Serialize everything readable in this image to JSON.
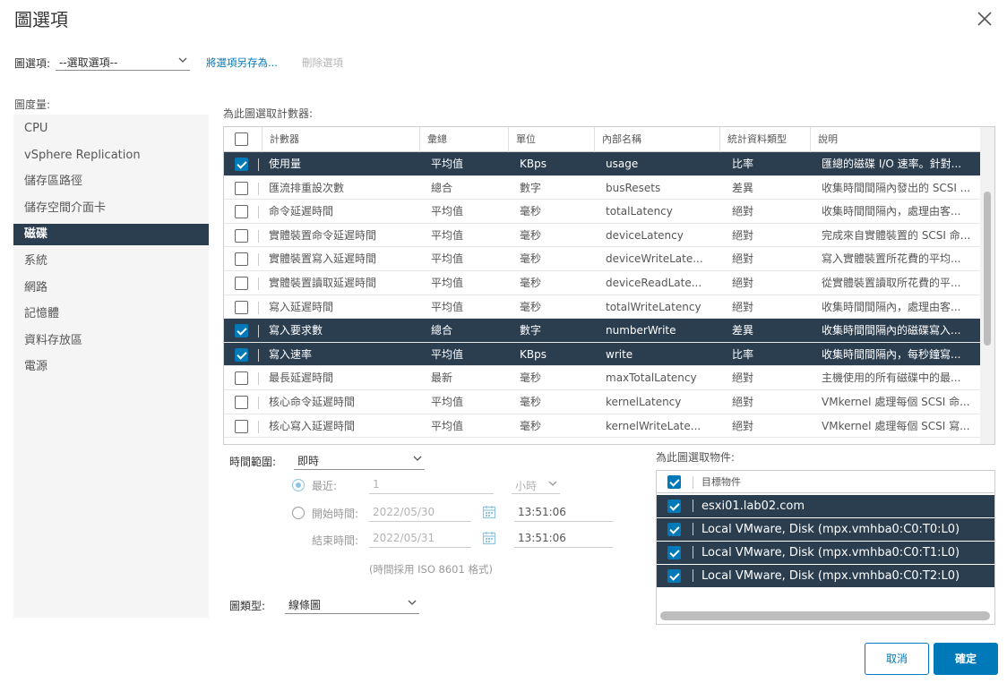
{
  "dialog": {
    "title": "圖選項"
  },
  "options": {
    "label": "圖選項:",
    "select_value": "--選取選項--",
    "save_as": "將選項另存為...",
    "delete": "刪除選項"
  },
  "metrics": {
    "label": "圖度量:",
    "items": [
      "CPU",
      "vSphere Replication",
      "儲存區路徑",
      "儲存空間介面卡",
      "磁碟",
      "系統",
      "網路",
      "記憶體",
      "資料存放區",
      "電源"
    ],
    "active": "磁碟"
  },
  "counters": {
    "label": "為此圖選取計數器:",
    "headers": [
      "計數器",
      "彙總",
      "單位",
      "內部名稱",
      "統計資料類型",
      "說明"
    ],
    "rows": [
      {
        "name": "使用量",
        "rollup": "平均值",
        "unit": "KBps",
        "internal": "usage",
        "stat": "比率",
        "desc": "匯總的磁碟 I/O 速率。針對...",
        "selected": true
      },
      {
        "name": "匯流排重設次數",
        "rollup": "總合",
        "unit": "數字",
        "internal": "busResets",
        "stat": "差異",
        "desc": "收集時間間隔內發出的 SCSI ...",
        "selected": false
      },
      {
        "name": "命令延遲時間",
        "rollup": "平均值",
        "unit": "毫秒",
        "internal": "totalLatency",
        "stat": "絕對",
        "desc": "收集時間間隔內，處理由客...",
        "selected": false
      },
      {
        "name": "實體裝置命令延遲時間",
        "rollup": "平均值",
        "unit": "毫秒",
        "internal": "deviceLatency",
        "stat": "絕對",
        "desc": "完成來自實體裝置的 SCSI 命...",
        "selected": false
      },
      {
        "name": "實體裝置寫入延遲時間",
        "rollup": "平均值",
        "unit": "毫秒",
        "internal": "deviceWriteLate...",
        "stat": "絕對",
        "desc": "寫入實體裝置所花費的平均...",
        "selected": false
      },
      {
        "name": "實體裝置讀取延遲時間",
        "rollup": "平均值",
        "unit": "毫秒",
        "internal": "deviceReadLate...",
        "stat": "絕對",
        "desc": "從實體裝置讀取所花費的平...",
        "selected": false
      },
      {
        "name": "寫入延遲時間",
        "rollup": "平均值",
        "unit": "毫秒",
        "internal": "totalWriteLatency",
        "stat": "絕對",
        "desc": "收集時間間隔內，處理由客...",
        "selected": false
      },
      {
        "name": "寫入要求數",
        "rollup": "總合",
        "unit": "數字",
        "internal": "numberWrite",
        "stat": "差異",
        "desc": "收集時間間隔內的磁碟寫入...",
        "selected": true
      },
      {
        "name": "寫入速率",
        "rollup": "平均值",
        "unit": "KBps",
        "internal": "write",
        "stat": "比率",
        "desc": "收集時間間隔內，每秒鐘寫...",
        "selected": true
      },
      {
        "name": "最長延遲時間",
        "rollup": "最新",
        "unit": "毫秒",
        "internal": "maxTotalLatency",
        "stat": "絕對",
        "desc": "主機使用的所有磁碟中的最...",
        "selected": false
      },
      {
        "name": "核心命令延遲時間",
        "rollup": "平均值",
        "unit": "毫秒",
        "internal": "kernelLatency",
        "stat": "絕對",
        "desc": "VMkernel 處理每個 SCSI 命...",
        "selected": false
      },
      {
        "name": "核心寫入延遲時間",
        "rollup": "平均值",
        "unit": "毫秒",
        "internal": "kernelWriteLate...",
        "stat": "絕對",
        "desc": "VMkernel 處理每個 SCSI 寫...",
        "selected": false
      }
    ]
  },
  "timerange": {
    "label": "時間範圍:",
    "value": "即時",
    "recent_label": "最近:",
    "recent_value": "1",
    "recent_unit": "小時",
    "start_label": "開始時間:",
    "start_date": "2022/05/30",
    "start_time": "13:51:06",
    "end_label": "結束時間:",
    "end_date": "2022/05/31",
    "end_time": "13:51:06",
    "hint": "(時間採用 ISO 8601 格式)"
  },
  "charttype": {
    "label": "圖類型:",
    "value": "線條圖"
  },
  "objects": {
    "label": "為此圖選取物件:",
    "header": "目標物件",
    "rows": [
      "esxi01.lab02.com",
      "Local VMware, Disk (mpx.vmhba0:C0:T0:L0)",
      "Local VMware, Disk (mpx.vmhba0:C0:T1:L0)",
      "Local VMware, Disk (mpx.vmhba0:C0:T2:L0)"
    ]
  },
  "buttons": {
    "cancel": "取消",
    "ok": "確定"
  },
  "colors": {
    "accent": "#0079b8",
    "selected_row": "#2b3e50"
  }
}
